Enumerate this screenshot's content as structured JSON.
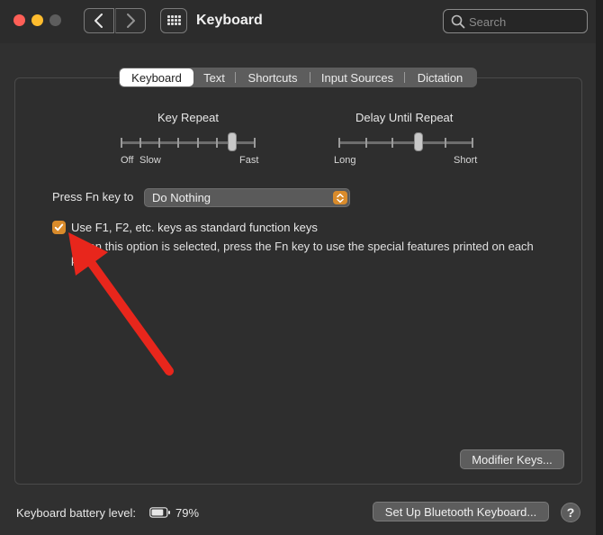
{
  "window": {
    "title": "Keyboard",
    "search_placeholder": "Search"
  },
  "tabs": [
    {
      "label": "Keyboard",
      "active": true
    },
    {
      "label": "Text",
      "active": false
    },
    {
      "label": "Shortcuts",
      "active": false
    },
    {
      "label": "Input Sources",
      "active": false
    },
    {
      "label": "Dictation",
      "active": false
    }
  ],
  "key_repeat": {
    "title": "Key Repeat",
    "labels": [
      "Off",
      "Slow",
      "Fast"
    ],
    "position": 0.85
  },
  "delay_until_repeat": {
    "title": "Delay Until Repeat",
    "labels": [
      "Long",
      "Short"
    ],
    "position": 0.6
  },
  "fn_key": {
    "label": "Press Fn key to",
    "value": "Do Nothing"
  },
  "function_keys_option": {
    "checked": true,
    "label": "Use F1, F2, etc. keys as standard function keys",
    "description": "When this option is selected, press the Fn key to use the special features printed on each key."
  },
  "buttons": {
    "modifier_keys": "Modifier Keys...",
    "setup_bluetooth": "Set Up Bluetooth Keyboard...",
    "help": "?"
  },
  "battery": {
    "label": "Keyboard battery level:",
    "level": "79%"
  },
  "colors": {
    "accent": "#d98b2b",
    "annotation_arrow": "#e8261c"
  },
  "icons": {
    "back": "chevron-left-icon",
    "forward": "chevron-right-icon",
    "grid": "grid-icon",
    "search": "search-icon",
    "battery": "battery-icon",
    "checkmark": "checkmark-icon",
    "select_arrows": "updown-chevron-icon"
  }
}
